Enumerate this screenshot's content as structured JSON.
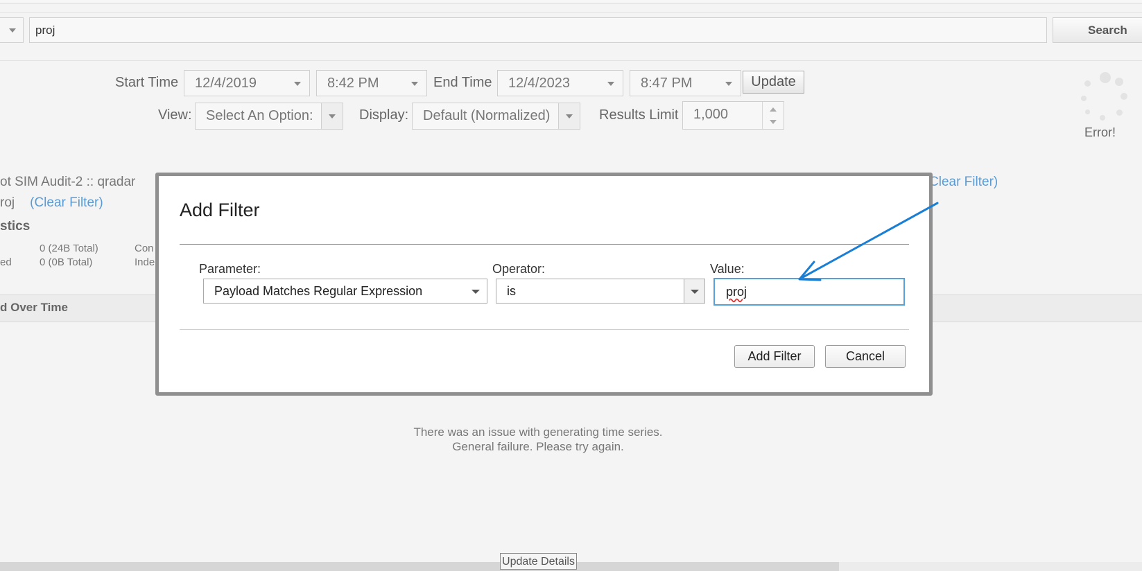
{
  "search": {
    "query": "proj",
    "button_label": "Search"
  },
  "time_controls": {
    "start_label": "Start Time",
    "start_date": "12/4/2019",
    "start_time": "8:42 PM",
    "end_label": "End Time",
    "end_date": "12/4/2023",
    "end_time": "8:47 PM",
    "update_label": "Update"
  },
  "view_controls": {
    "view_label": "View:",
    "view_value": "Select An Option:",
    "display_label": "Display:",
    "display_value": "Default (Normalized)",
    "limit_label": "Results Limit",
    "limit_value": "1,000"
  },
  "status": {
    "error_text": "Error!"
  },
  "background": {
    "filter_line1": "ot SIM Audit-2 :: qradar",
    "filter_line2_prefix": "roj",
    "clear_filter": "(Clear Filter)",
    "clear_filter_right": "Clear Filter)",
    "stats_heading": "stics",
    "stat_row1_value": "0 (24B Total)",
    "stat_row1_next": "Con",
    "stat_row2_label": "ed",
    "stat_row2_value": "0 (0B Total)",
    "stat_row2_next": "Inde",
    "section_title": "d Over Time",
    "message_line1": "There was an issue with generating time series.",
    "message_line2": "General failure. Please try again.",
    "update_details": "Update Details"
  },
  "modal": {
    "title": "Add Filter",
    "parameter_label": "Parameter:",
    "parameter_value": "Payload Matches Regular Expression",
    "operator_label": "Operator:",
    "operator_value": "is",
    "value_label": "Value:",
    "value_text": "proj",
    "add_button": "Add Filter",
    "cancel_button": "Cancel"
  },
  "colors": {
    "arrow": "#1a7fd4",
    "link": "#5a9bd5",
    "input_border": "#56a2d8"
  }
}
